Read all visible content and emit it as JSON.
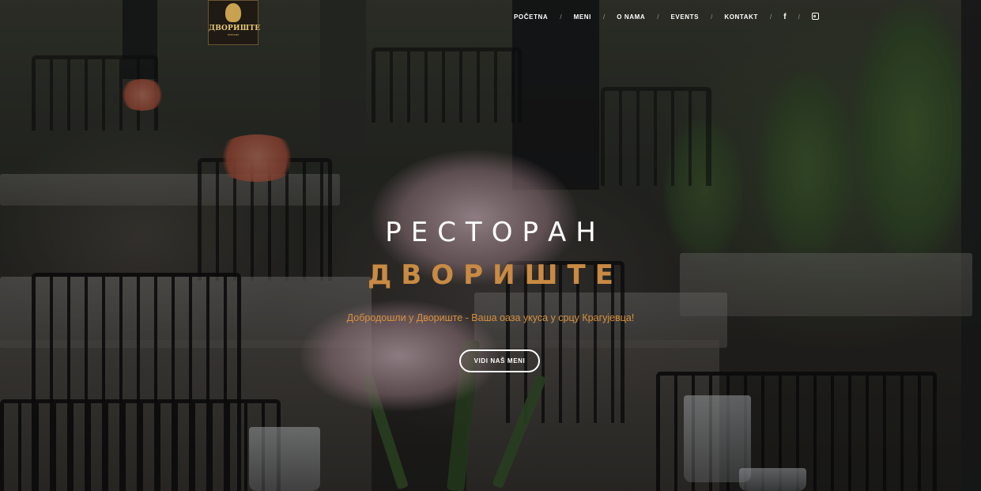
{
  "logo": {
    "title": "ДВОРИШТЕ",
    "subtitle": "restoran"
  },
  "nav": {
    "items": [
      {
        "label": "POČETNA"
      },
      {
        "label": "MENI"
      },
      {
        "label": "O NAMA"
      },
      {
        "label": "EVENTS"
      },
      {
        "label": "KONTAKT"
      }
    ],
    "separator": "/",
    "social": {
      "facebook_glyph": "f",
      "icons": [
        "facebook-icon",
        "instagram-icon"
      ]
    }
  },
  "hero": {
    "title": "РЕСТОРАН",
    "subtitle": "ДВОРИШТЕ",
    "tagline": "Добродошли у Двориште - Ваша оаза укуса у срцу Крагујевца!",
    "cta_label": "VIDI NAŠ MENI"
  },
  "colors": {
    "accent": "#c98a43",
    "tagline": "#d7913f",
    "text": "#ffffff"
  }
}
